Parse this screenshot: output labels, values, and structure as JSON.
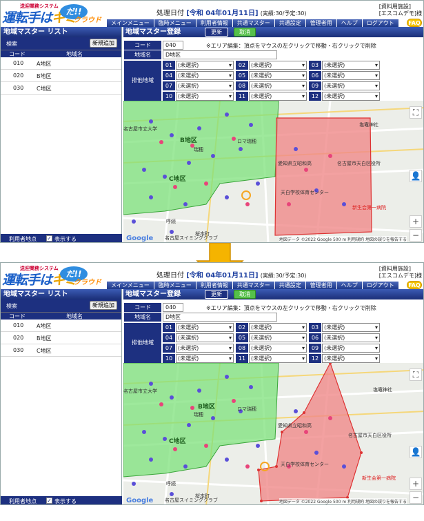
{
  "app": {
    "logo_sub": "送迎業務システム",
    "logo_main": "運転手はキミだ!!",
    "logo_main_a": "運転手は",
    "logo_main_b": "キミ",
    "logo_bubble": "だ!!",
    "logo_cloud": "クラウド",
    "proc_label": "処理日付",
    "proc_date": "[令和 04年01月11日]",
    "proc_stats": "(実績:30/予定:30)",
    "facility": "[資料用施設]",
    "company": "[エスコムデモ]様",
    "faq": "FAQ",
    "menu": [
      "メインメニュー",
      "臨時メニュー",
      "利用者情報",
      "共通マスター",
      "共通設定",
      "管理者用",
      "ヘルプ",
      "ログアウト"
    ]
  },
  "left": {
    "title": "地域マスター リスト",
    "search_label": "検索",
    "new_button": "新規追加",
    "col_code": "コード",
    "col_name": "地域名",
    "rows": [
      {
        "code": "010",
        "name": "A地区"
      },
      {
        "code": "020",
        "name": "B地区"
      },
      {
        "code": "030",
        "name": "C地区"
      }
    ],
    "user_point_label": "利用者地点",
    "show_label": "表示する",
    "show_checked": true
  },
  "right": {
    "title": "地域マスター登録",
    "update_button": "更新",
    "cancel_button": "取消",
    "code_label": "コード",
    "code_value": "040",
    "note": "※エリア編集：頂点をマウスの左クリックで移動・右クリックで削除",
    "name_label": "地域名",
    "name_value": "D地区",
    "other_label": "排他地域",
    "slots": [
      {
        "no": "01",
        "value": "(未選択)"
      },
      {
        "no": "02",
        "value": "(未選択)"
      },
      {
        "no": "03",
        "value": "(未選択)"
      },
      {
        "no": "04",
        "value": "(未選択)"
      },
      {
        "no": "05",
        "value": "(未選択)"
      },
      {
        "no": "06",
        "value": "(未選択)"
      },
      {
        "no": "07",
        "value": "(未選択)"
      },
      {
        "no": "08",
        "value": "(未選択)"
      },
      {
        "no": "09",
        "value": "(未選択)"
      },
      {
        "no": "10",
        "value": "(未選択)"
      },
      {
        "no": "11",
        "value": "(未選択)"
      },
      {
        "no": "12",
        "value": "(未選択)"
      }
    ]
  },
  "map": {
    "google": "Google",
    "footer": "地図データ ©2022 Google  500 m  利用規約  地図の誤りを報告する",
    "labels": [
      "B地区",
      "C地区",
      "D地区",
      "名古屋市立大学",
      "愛知県立昭和高",
      "名古屋市天白区役所",
      "天白学校体育センター",
      "新生会第一病院",
      "瑞穂",
      "名古屋スイミングクラブ",
      "ロマ瑞穂",
      "桜本町",
      "呼続",
      "塩竈神社"
    ]
  },
  "colors": {
    "nav": "#1d3080",
    "green_zone": "#7ee27b",
    "red_zone": "#f08a8a",
    "arrow": "#f5b400"
  }
}
